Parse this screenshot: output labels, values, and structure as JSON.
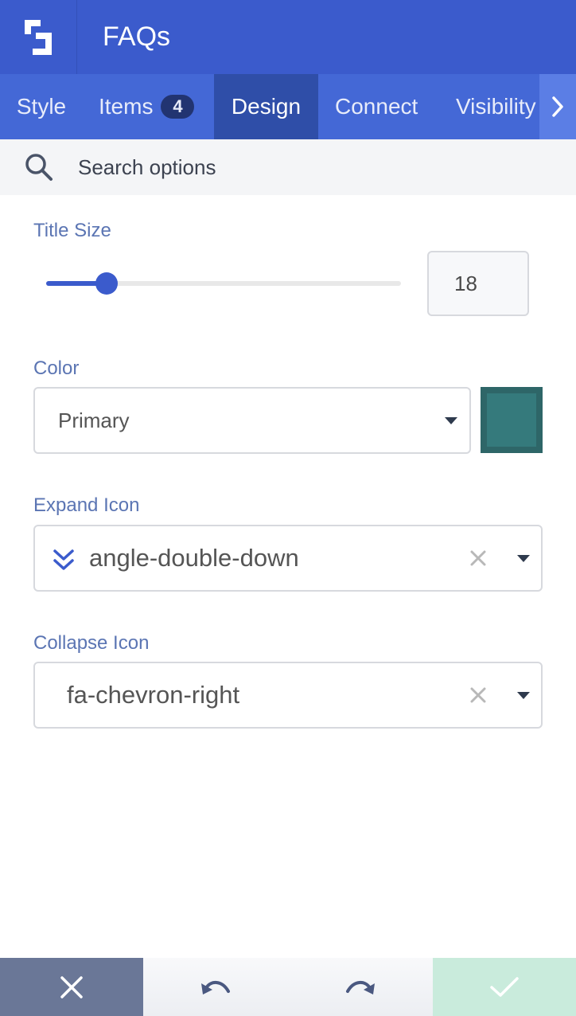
{
  "header": {
    "title": "FAQs",
    "logo_icon": "builder-logo-icon"
  },
  "tabs": [
    {
      "label": "Style",
      "active": false
    },
    {
      "label": "Items",
      "badge": "4",
      "active": false
    },
    {
      "label": "Design",
      "active": true
    },
    {
      "label": "Connect",
      "active": false
    },
    {
      "label": "Visibility",
      "active": false
    }
  ],
  "search": {
    "placeholder": "Search options"
  },
  "title_size": {
    "label": "Title Size",
    "value": "18",
    "slider_fraction": 0.17
  },
  "color": {
    "label": "Color",
    "selected": "Primary",
    "swatch": "#357a7c"
  },
  "expand_icon": {
    "label": "Expand Icon",
    "selected": "angle-double-down",
    "icon": "angle-double-down-icon"
  },
  "collapse_icon": {
    "label": "Collapse Icon",
    "selected": "fa-chevron-right"
  },
  "colors": {
    "header": "#3b5bcc",
    "tabs": "#4468d6",
    "tab_active": "#2f4ea8",
    "accent": "#3b5bcc",
    "confirm": "#c9ebdc",
    "cancel": "#6a7797"
  }
}
